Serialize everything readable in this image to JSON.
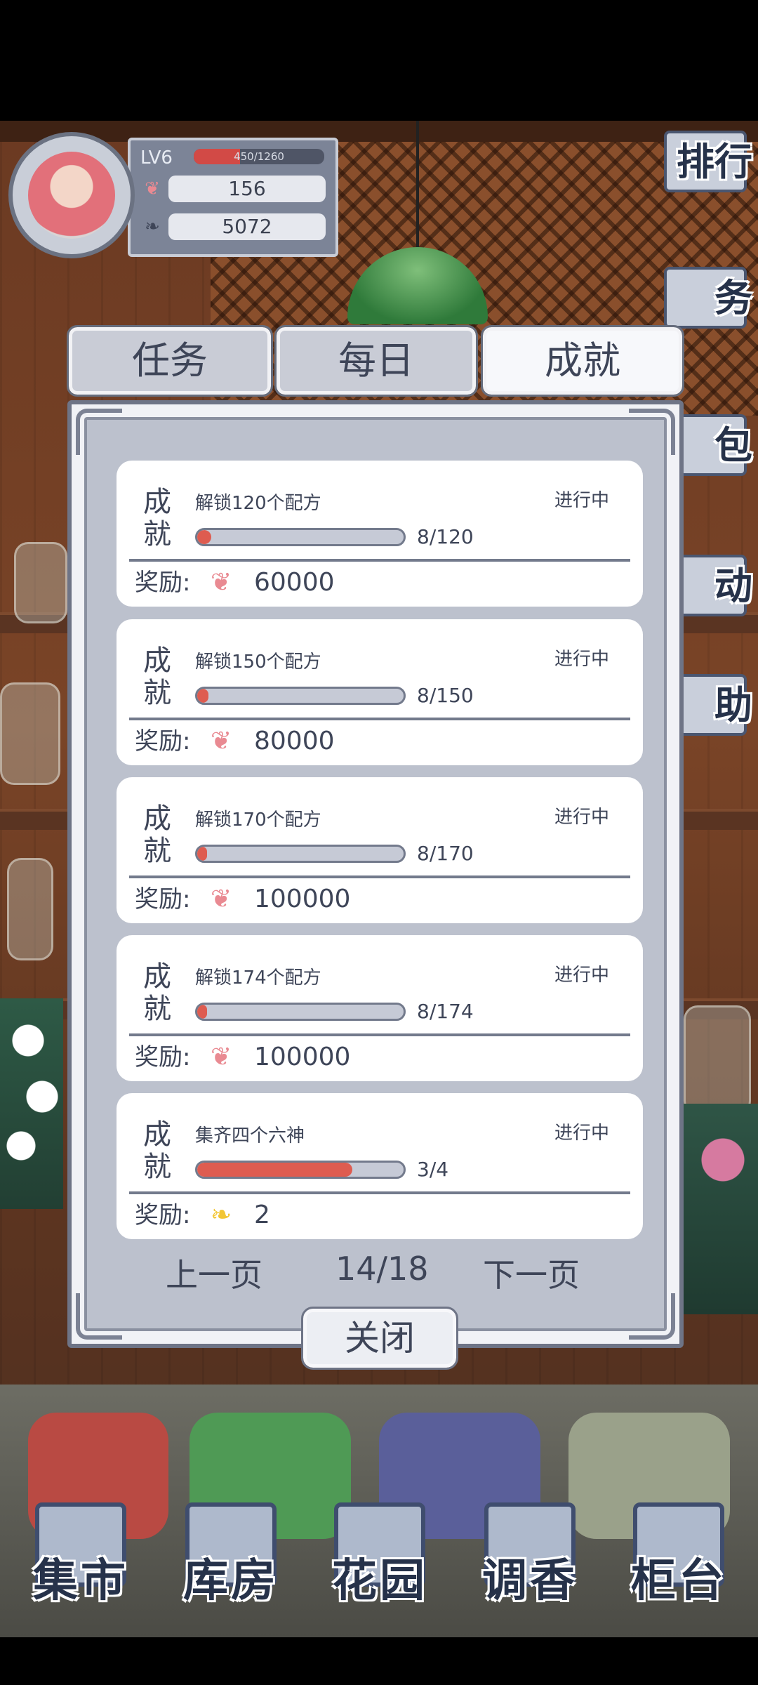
{
  "player": {
    "level": "LV6",
    "exp_text": "450/1260",
    "exp_progress": 0.357,
    "petals": "156",
    "leaves": "5072"
  },
  "side_menu": [
    {
      "label": "排行",
      "icon": "ranking-icon"
    },
    {
      "label": "务",
      "icon": "task-icon"
    },
    {
      "label": "包",
      "icon": "bag-icon"
    },
    {
      "label": "动",
      "icon": "event-icon"
    },
    {
      "label": "助",
      "icon": "help-icon"
    }
  ],
  "tabs": {
    "tasks": "任务",
    "daily": "每日",
    "achievements": "成就",
    "active": "achievements"
  },
  "achievements": [
    {
      "tag": "成就",
      "title": "解锁120个配方",
      "status": "进行中",
      "progress": "8/120",
      "ratio": 0.0667,
      "reward_label": "奖励:",
      "reward_icon": "petal-icon",
      "reward_value": "60000"
    },
    {
      "tag": "成就",
      "title": "解锁150个配方",
      "status": "进行中",
      "progress": "8/150",
      "ratio": 0.0533,
      "reward_label": "奖励:",
      "reward_icon": "petal-icon",
      "reward_value": "80000"
    },
    {
      "tag": "成就",
      "title": "解锁170个配方",
      "status": "进行中",
      "progress": "8/170",
      "ratio": 0.047,
      "reward_label": "奖励:",
      "reward_icon": "petal-icon",
      "reward_value": "100000"
    },
    {
      "tag": "成就",
      "title": "解锁174个配方",
      "status": "进行中",
      "progress": "8/174",
      "ratio": 0.046,
      "reward_label": "奖励:",
      "reward_icon": "petal-icon",
      "reward_value": "100000"
    },
    {
      "tag": "成就",
      "title": "集齐四个六神",
      "status": "进行中",
      "progress": "3/4",
      "ratio": 0.75,
      "reward_label": "奖励:",
      "reward_icon": "gold-leaf-icon",
      "reward_value": "2"
    }
  ],
  "pager": {
    "prev": "上一页",
    "page": "14/18",
    "next": "下一页"
  },
  "close_label": "关闭",
  "bottom_nav": [
    {
      "label": "集市",
      "icon": "market-icon"
    },
    {
      "label": "库房",
      "icon": "warehouse-icon"
    },
    {
      "label": "花园",
      "icon": "garden-icon"
    },
    {
      "label": "调香",
      "icon": "perfume-icon"
    },
    {
      "label": "柜台",
      "icon": "counter-icon"
    }
  ],
  "colors": {
    "progress_fill": "#de5c50",
    "petal": "#e98a92",
    "gold_leaf": "#f2c634",
    "ink": "#3e4558"
  }
}
